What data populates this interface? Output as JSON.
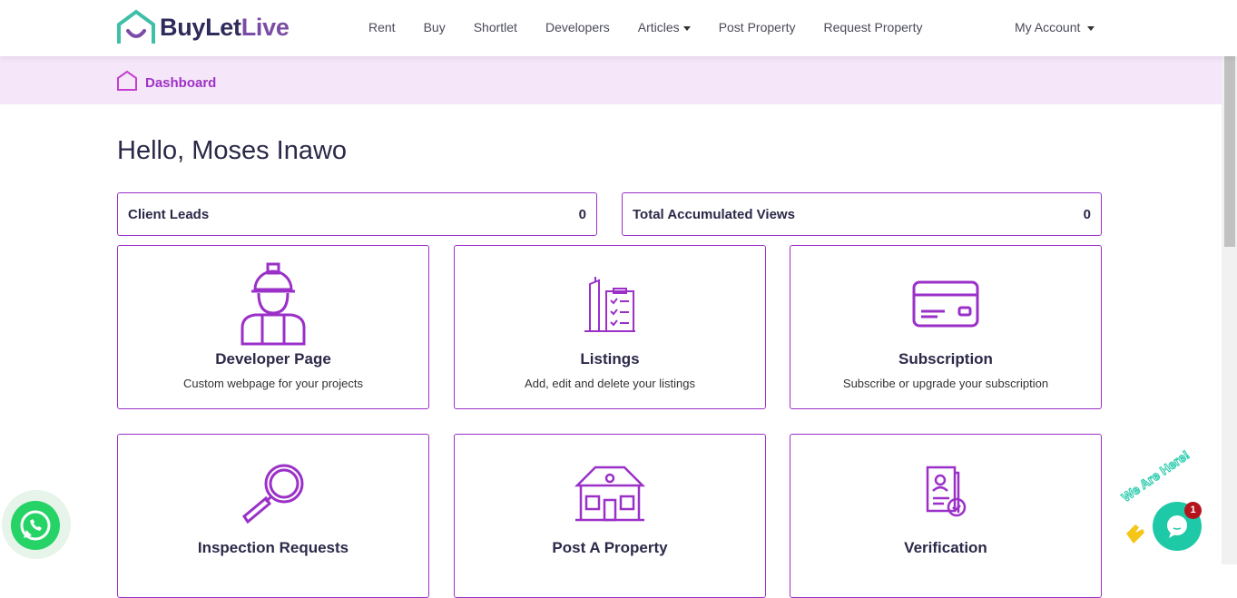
{
  "brand": {
    "name_a": "BuyLet",
    "name_b": "Live"
  },
  "nav": {
    "items": [
      "Rent",
      "Buy",
      "Shortlet",
      "Developers",
      "Articles",
      "Post Property",
      "Request Property"
    ],
    "account": "My Account"
  },
  "breadcrumb": "Dashboard",
  "greeting": "Hello, Moses Inawo",
  "stats": [
    {
      "label": "Client Leads",
      "value": "0"
    },
    {
      "label": "Total Accumulated Views",
      "value": "0"
    }
  ],
  "cards": [
    {
      "title": "Developer Page",
      "desc": "Custom webpage for your projects",
      "icon": "worker-icon"
    },
    {
      "title": "Listings",
      "desc": "Add, edit and delete your listings",
      "icon": "building-checklist-icon"
    },
    {
      "title": "Subscription",
      "desc": "Subscribe or upgrade your subscription",
      "icon": "credit-card-icon"
    },
    {
      "title": "Inspection Requests",
      "desc": "",
      "icon": "magnifier-icon"
    },
    {
      "title": "Post A Property",
      "desc": "",
      "icon": "house-icon"
    },
    {
      "title": "Verification",
      "desc": "",
      "icon": "certificate-icon"
    }
  ],
  "chat": {
    "tagline": "We Are Here!",
    "badge": "1"
  },
  "colors": {
    "accent": "#9b30c8",
    "teal": "#1ec9a8",
    "navy": "#2b2948"
  }
}
